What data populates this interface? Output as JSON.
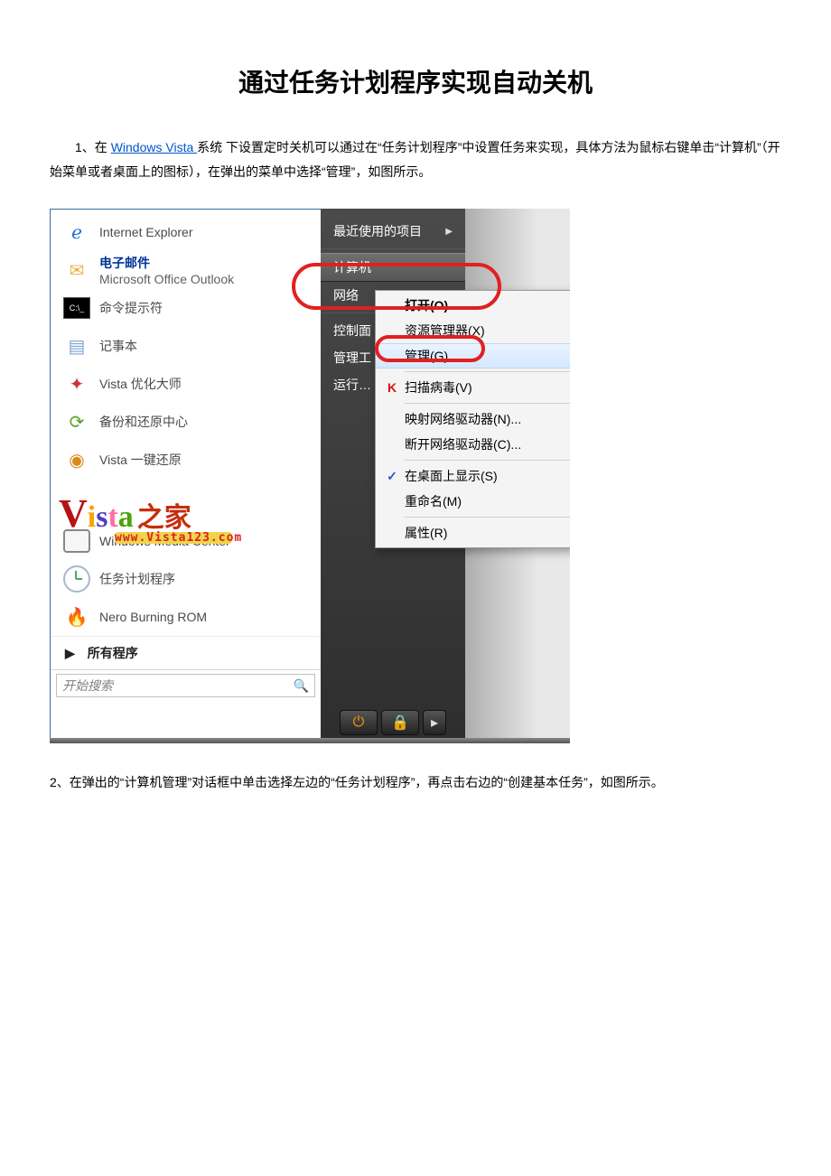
{
  "doc": {
    "title": "通过任务计划程序实现自动关机",
    "p1_a": "　　1、在 ",
    "p1_link": "Windows Vista ",
    "p1_b": "系统  下设置定时关机可以通过在“任务计划程序”中设置任务来实现，具体方法为鼠标右键单击“计算机”（开始菜单或者桌面上的图标），在弹出的菜单中选择“管理”，如图所示。",
    "p2": "2、在弹出的“计算机管理”对话框中单击选择左边的“任务计划程序”，再点击右边的“创建基本任务”，如图所示。"
  },
  "leftPane": {
    "ie": "Internet Explorer",
    "email_title": "电子邮件",
    "email_desc": "Microsoft Office Outlook",
    "cmd": "命令提示符",
    "notepad": "记事本",
    "opt": "Vista 优化大师",
    "backup": "备份和还原中心",
    "restore": "Vista 一键还原",
    "wmc": "Windows Media Center",
    "task": "任务计划程序",
    "nero": "Nero Burning ROM",
    "all": "所有程序",
    "search": "开始搜索"
  },
  "rightPane": {
    "recent": "最近使用的项目",
    "computer": "计算机",
    "network": "网络",
    "control": "控制面",
    "admin": "管理工",
    "run": "运行…"
  },
  "ctx": {
    "open": "打开(O)",
    "explorer": "资源管理器(X)",
    "manage": "管理(G)",
    "scan": "扫描病毒(V)",
    "map": "映射网络驱动器(N)...",
    "disconnect": "断开网络驱动器(C)...",
    "desktop": "在桌面上显示(S)",
    "rename": "重命名(M)",
    "prop": "属性(R)"
  },
  "logo": {
    "cn": "之家",
    "url": "www.Vista123.com"
  }
}
